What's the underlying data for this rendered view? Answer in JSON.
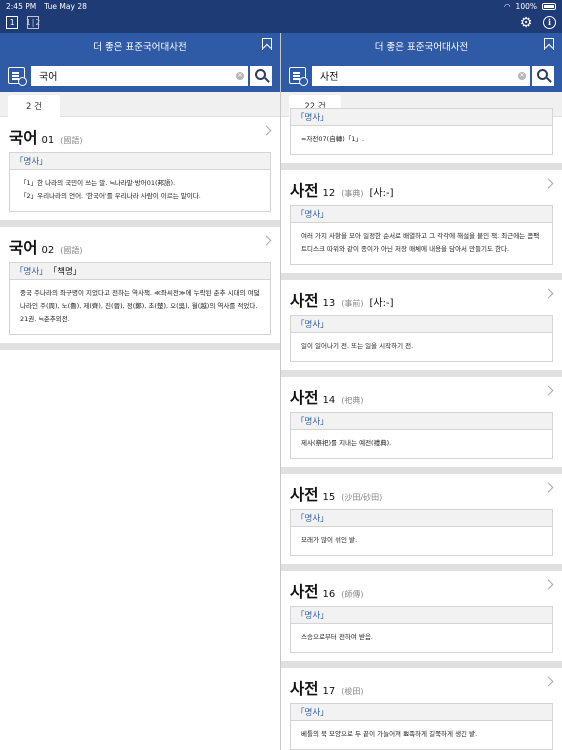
{
  "status": {
    "time": "2:45 PM",
    "date": "Tue May 28",
    "battery": "100%"
  },
  "topbar": {
    "single_view": "1",
    "dual_view": "1|2"
  },
  "left": {
    "title": "더 좋은 표준국어대사전",
    "search_value": "국어",
    "count": "2 건",
    "entries": [
      {
        "word": "국어",
        "num": "01",
        "hanja": "(國語)",
        "pos": "「명사」",
        "defs": [
          "「1」한 나라의 국민이 쓰는 말. ≒나라말·방어01(邦語).",
          "「2」우리나라의 언어. '한국어'를 우리나라 사람이 이르는 말이다."
        ]
      },
      {
        "word": "국어",
        "num": "02",
        "hanja": "(國語)",
        "pos": "「명사」",
        "pos_extra": "「책명」",
        "defs": [
          "중국 주나라의 좌구명이 지었다고 전하는 역사책. ≪좌씨전≫에 누락된 춘추 시대의 여덟 나라인 주(周), 노(魯), 제(齊), 진(晉), 정(鄭), 초(楚), 오(吳), 월(越)의 역사를 적었다. 21권. ≒춘추외전."
        ]
      }
    ]
  },
  "right": {
    "title": "더 좋은 표준국어대사전",
    "search_value": "사전",
    "count": "22 건",
    "partial": {
      "pos": "「명사」",
      "def": "=자전07(自轉)「1」."
    },
    "entries": [
      {
        "word": "사전",
        "num": "12",
        "hanja": "(事典)",
        "pron": "[사:-]",
        "pos": "「명사」",
        "def": "여러 가지 사항을 모아 일정한 순서로 배열하고 그 각각에 해설을 붙인 책. 최근에는 콤팩트디스크 따위와 같이 종이가 아닌 저장 매체에 내용을 담아서 만들기도 한다."
      },
      {
        "word": "사전",
        "num": "13",
        "hanja": "(事前)",
        "pron": "[사:-]",
        "pos": "「명사」",
        "def": "일이 일어나기 전. 또는 일을 시작하기 전."
      },
      {
        "word": "사전",
        "num": "14",
        "hanja": "(祀典)",
        "pron": "",
        "pos": "「명사」",
        "def": "제사(祭祀)를 지내는 예전(禮典)."
      },
      {
        "word": "사전",
        "num": "15",
        "hanja": "(沙田/砂田)",
        "pron": "",
        "pos": "「명사」",
        "def": "모래가 많이 섞인 밭."
      },
      {
        "word": "사전",
        "num": "16",
        "hanja": "(師傳)",
        "pron": "",
        "pos": "「명사」",
        "def": "스승으로부터 전하여 받음."
      },
      {
        "word": "사전",
        "num": "17",
        "hanja": "(梭田)",
        "pron": "",
        "pos": "「명사」",
        "def": "베틀의 북 모양으로 두 끝이 가늘어져 뾰족하게 길쭉하게 생긴 밭."
      }
    ]
  }
}
